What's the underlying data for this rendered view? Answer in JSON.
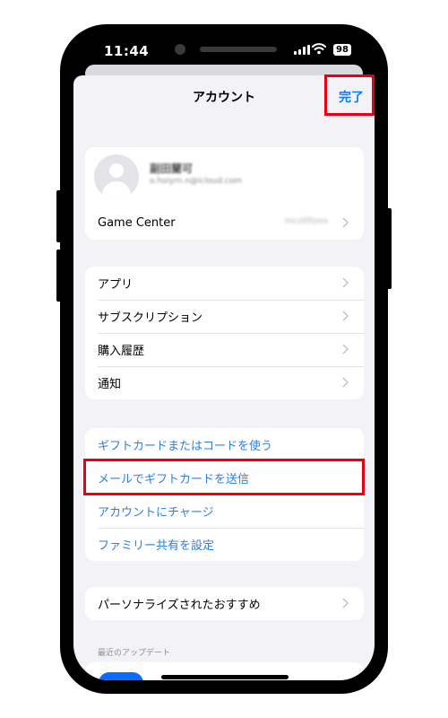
{
  "status_bar": {
    "time": "11:44",
    "signal_icon": "cellular-signal-icon",
    "wifi_icon": "wifi-icon",
    "battery": "98"
  },
  "nav": {
    "title": "アカウント",
    "done_label": "完了"
  },
  "profile": {
    "name": "副田蘭可",
    "email": "o.hoiyrn.n@icloud.com",
    "avatar_icon": "person-placeholder-icon"
  },
  "game_center": {
    "label": "Game Center",
    "value": "nicollfooo"
  },
  "menu_items": [
    {
      "label": "アプリ"
    },
    {
      "label": "サブスクリプション"
    },
    {
      "label": "購入履歴"
    },
    {
      "label": "通知"
    }
  ],
  "gift_items": [
    {
      "label": "ギフトカードまたはコードを使う"
    },
    {
      "label": "メールでギフトカードを送信"
    },
    {
      "label": "アカウントにチャージ"
    },
    {
      "label": "ファミリー共有を設定"
    }
  ],
  "personalized": {
    "label": "パーソナライズされたおすすめ"
  },
  "recent_updates_header": "最近のアップデート",
  "colors": {
    "accent": "#0a7aff",
    "link": "#2d7fe0",
    "highlight": "#e60012",
    "background": "#f2f2f7"
  }
}
